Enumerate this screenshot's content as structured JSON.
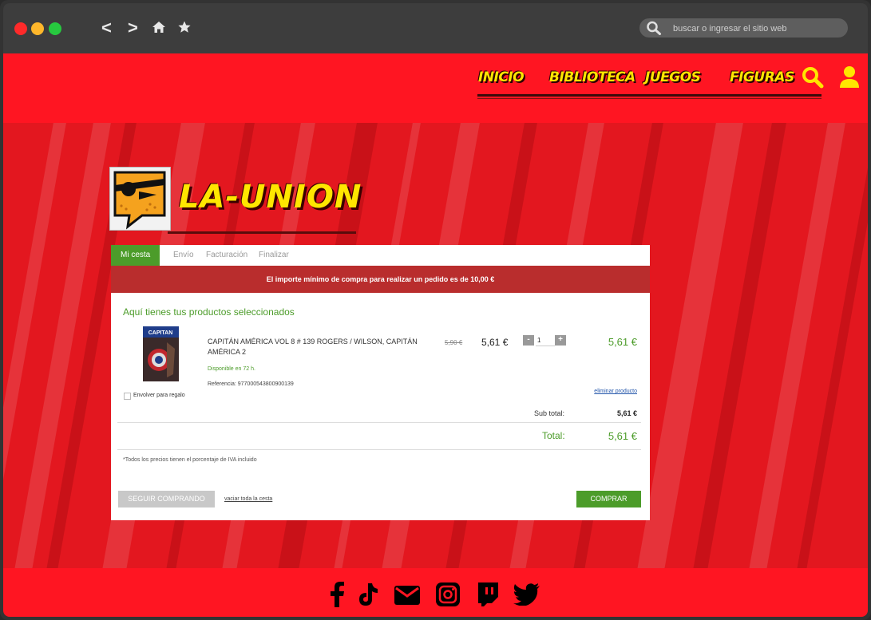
{
  "browser": {
    "back_icon": "chevron-left",
    "forward_icon": "chevron-right",
    "home_icon": "home",
    "bookmark_icon": "star",
    "url_placeholder": "buscar o ingresar el sitio web",
    "back_label": "<",
    "forward_label": ">"
  },
  "header": {
    "nav": [
      "INICIO",
      "BIBLIOTECA",
      "JUEGOS",
      "FIGURAS"
    ],
    "brand": "LA-UNION",
    "accent": "#ff1522",
    "nav_color": "#ffe600"
  },
  "checkout": {
    "steps": [
      "Mi cesta",
      "Envío",
      "Facturación",
      "Finalizar"
    ],
    "notice": "El importe mínimo de compra para realizar un pedido es de 10,00 €",
    "section_title": "Aquí tienes tus productos seleccionados",
    "product": {
      "title": "CAPITÁN AMÉRICA VOL 8 # 139 ROGERS / WILSON, CAPITÁN AMÉRICA 2",
      "availability": "Disponible en 72 h.",
      "reference": "Referencia: 977000543800900139",
      "old_price": "5,90 €",
      "price": "5,61 €",
      "quantity": "1",
      "line_total": "5,61 €",
      "remove_label": "eliminar producto",
      "gift_label": "Envolver para regalo"
    },
    "subtotal_label": "Sub total:",
    "subtotal_value": "5,61 €",
    "total_label": "Total:",
    "total_value": "5,61 €",
    "vat_note": "*Todos los precios tienen el porcentaje de IVA incluido",
    "continue_label": "SEGUIR COMPRANDO",
    "empty_label": "vaciar toda la cesta",
    "buy_label": "COMPRAR",
    "minus": "-",
    "plus": "+",
    "green": "#4c9c2a"
  },
  "footer": {
    "social": [
      "facebook",
      "tiktok",
      "email",
      "instagram",
      "twitch",
      "twitter"
    ]
  }
}
